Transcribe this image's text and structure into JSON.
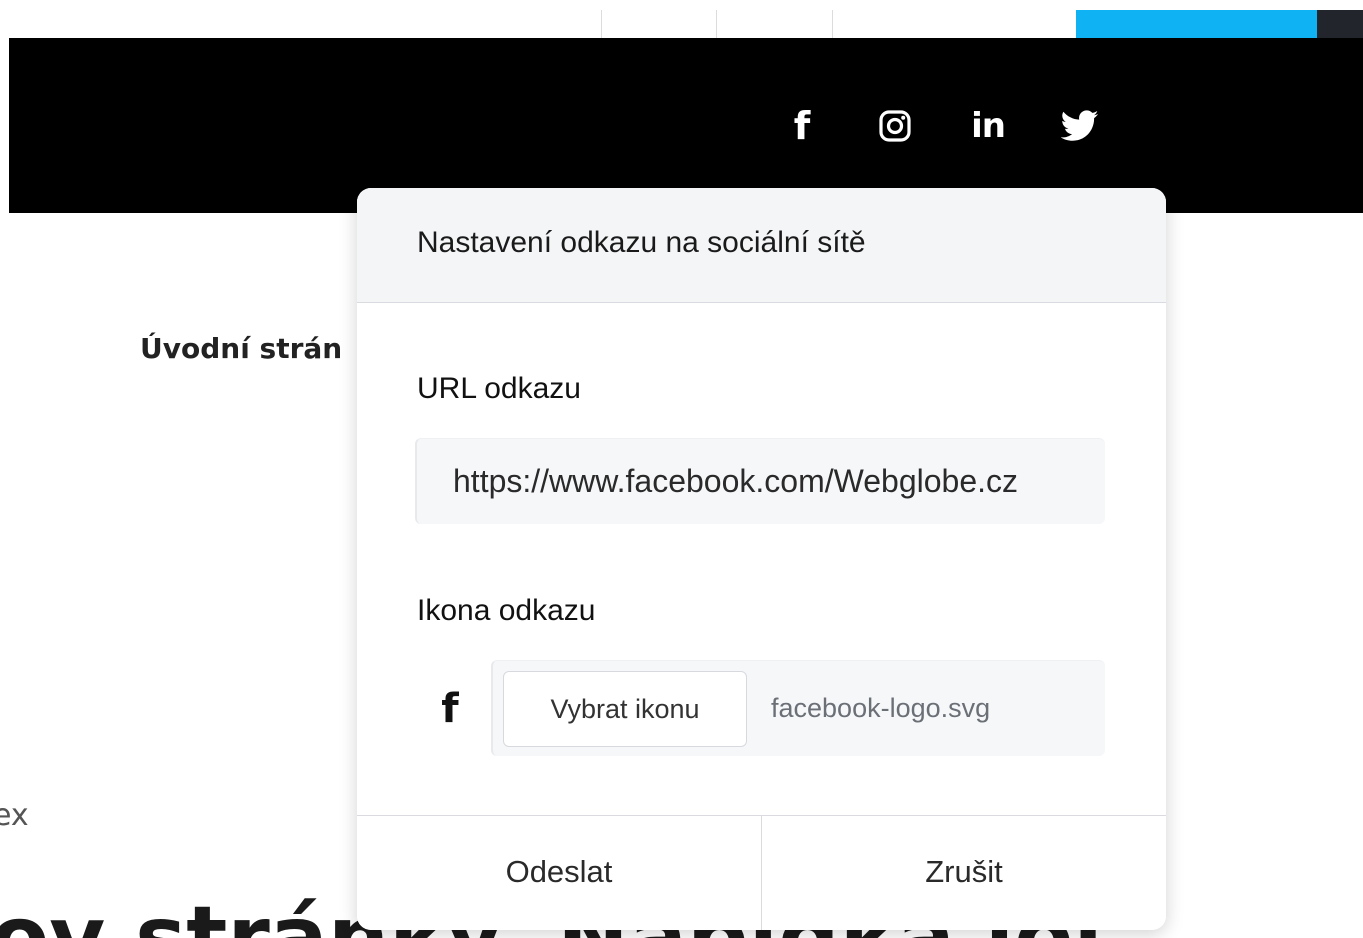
{
  "header": {
    "social_icons": [
      {
        "icon": "facebook-icon"
      },
      {
        "icon": "instagram-icon"
      },
      {
        "icon": "linkedin-icon"
      },
      {
        "icon": "twitter-icon"
      }
    ],
    "facebook_glyph": "f",
    "linkedin_glyph": "in"
  },
  "background": {
    "nav_item": "Úvodní strán",
    "fragment": "ex",
    "heading": "ov stránky. Nabídka loi"
  },
  "dialog": {
    "title": "Nastavení odkazu na sociální sítě",
    "url_label": "URL odkazu",
    "url_value": "https://www.facebook.com/Webglobe.cz",
    "icon_label": "Ikona odkazu",
    "icon_preview_glyph": "f",
    "choose_icon_button": "Vybrat ikonu",
    "file_name": "facebook-logo.svg",
    "submit_button": "Odeslat",
    "cancel_button": "Zrušit"
  },
  "colors": {
    "accent": "#0fb2f2",
    "header_bg": "#000000",
    "dialog_header_bg": "#f4f5f7"
  }
}
